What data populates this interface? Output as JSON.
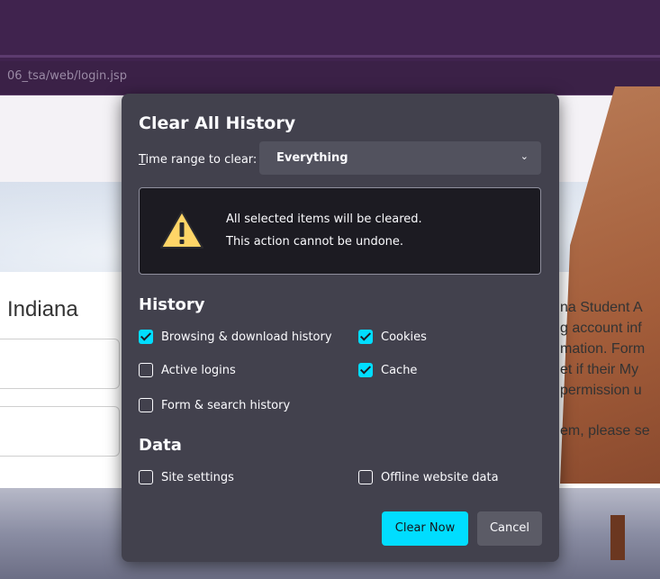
{
  "browser": {
    "url": "06_tsa/web/login.jsp"
  },
  "page": {
    "left_title": "Indiana",
    "right_lines": [
      "na Student A",
      "g account inf",
      "mation. Form",
      "et if their My",
      "permission u"
    ],
    "right_line_bottom": "em, please se"
  },
  "dialog": {
    "title": "Clear All History",
    "range_label_prefix": "T",
    "range_label_rest": "ime range to clear:",
    "range_value": "Everything",
    "warning_line1": "All selected items will be cleared.",
    "warning_line2": "This action cannot be undone.",
    "history_heading": "History",
    "data_heading": "Data",
    "items": {
      "browsing": {
        "label": "Browsing & download history",
        "checked": true
      },
      "cookies": {
        "label": "Cookies",
        "checked": true
      },
      "logins": {
        "label": "Active logins",
        "checked": false
      },
      "cache": {
        "label": "Cache",
        "checked": true
      },
      "forms": {
        "label": "Form & search history",
        "checked": false
      },
      "site_settings": {
        "label": "Site settings",
        "checked": false
      },
      "offline": {
        "label": "Offline website data",
        "checked": false
      }
    },
    "clear_button": "Clear Now",
    "cancel_button": "Cancel"
  },
  "colors": {
    "accent": "#00ddff",
    "dialog_bg": "#42414d",
    "chrome": "#40234e"
  }
}
